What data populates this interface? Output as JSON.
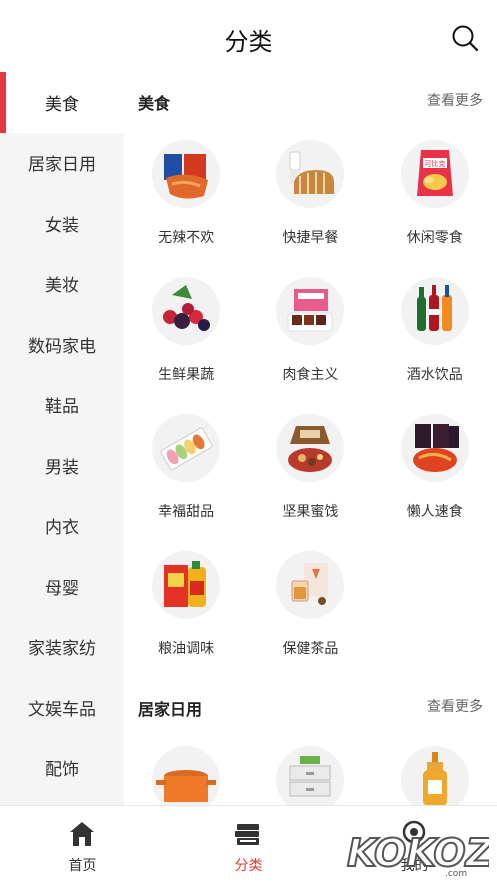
{
  "header": {
    "title": "分类",
    "search_icon": "search-icon"
  },
  "sidebar": {
    "items": [
      {
        "label": "美食",
        "active": true
      },
      {
        "label": "居家日用"
      },
      {
        "label": "女装"
      },
      {
        "label": "美妆"
      },
      {
        "label": "数码家电"
      },
      {
        "label": "鞋品"
      },
      {
        "label": "男装"
      },
      {
        "label": "内衣"
      },
      {
        "label": "母婴"
      },
      {
        "label": "家装家纺"
      },
      {
        "label": "文娱车品"
      },
      {
        "label": "配饰"
      }
    ]
  },
  "main": {
    "sections": [
      {
        "title": "美食",
        "more": "查看更多",
        "items": [
          {
            "label": "无辣不欢",
            "icon": "spicy-snack-icon"
          },
          {
            "label": "快捷早餐",
            "icon": "bread-icon"
          },
          {
            "label": "休闲零食",
            "icon": "chips-icon"
          },
          {
            "label": "生鲜果蔬",
            "icon": "berries-icon"
          },
          {
            "label": "肉食主义",
            "icon": "meat-icon"
          },
          {
            "label": "酒水饮品",
            "icon": "drinks-icon"
          },
          {
            "label": "幸福甜品",
            "icon": "macaron-icon"
          },
          {
            "label": "坚果蜜饯",
            "icon": "nuts-icon"
          },
          {
            "label": "懒人速食",
            "icon": "instant-noodle-icon"
          },
          {
            "label": "粮油调味",
            "icon": "oil-rice-icon"
          },
          {
            "label": "保健茶品",
            "icon": "tea-icon"
          }
        ]
      },
      {
        "title": "居家日用",
        "more": "查看更多",
        "items": [
          {
            "label": "",
            "icon": "pot-icon"
          },
          {
            "label": "",
            "icon": "storage-box-icon"
          },
          {
            "label": "",
            "icon": "bottle-icon"
          }
        ]
      }
    ]
  },
  "tabbar": {
    "items": [
      {
        "label": "首页",
        "icon": "home-icon"
      },
      {
        "label": "分类",
        "icon": "books-icon",
        "active": true
      },
      {
        "label": "我的",
        "icon": "profile-icon"
      }
    ]
  },
  "watermark": {
    "text": "KOKOZ.com"
  },
  "colors": {
    "accent": "#e4393c",
    "sidebar_bg": "#f5f5f5"
  }
}
